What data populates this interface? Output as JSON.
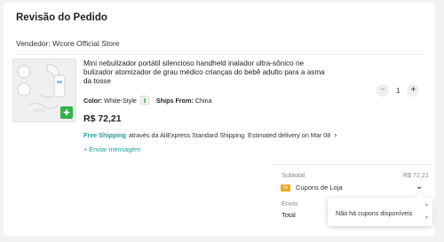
{
  "review": {
    "title": "Revisão do Pedido",
    "seller": "Vendedor: Wcore Official Store"
  },
  "product": {
    "name": "Mini nebulizador portátil silencioso handheld inalador ultra-sônico ne bulizador atomizador de grau médico crianças do bebê adulto para a asma da tosse",
    "color_label": "Color:",
    "color_value": "White-Style",
    "ships_label": "Ships From:",
    "ships_value": "China",
    "price": "R$ 72,21",
    "shipping_free": "Free Shipping",
    "shipping_detail": "através da AliExpress Standard Shipping. Estimated delivery on Mar 08",
    "send_message": "+ Enviar mensagem",
    "quantity": "1"
  },
  "summary": {
    "subtotal_label": "Subtotal",
    "subtotal_value": "R$ 72,21",
    "coupon_label": "Cupons de Loja",
    "shipping_label": "Envio",
    "total_label": "Total"
  },
  "coupon_popup": {
    "text": "Não há cupons disponíveis"
  },
  "colors": {
    "accent_teal": "#1a9d9b",
    "coupon_orange": "#f5a623",
    "gift_green": "#35b34a"
  }
}
